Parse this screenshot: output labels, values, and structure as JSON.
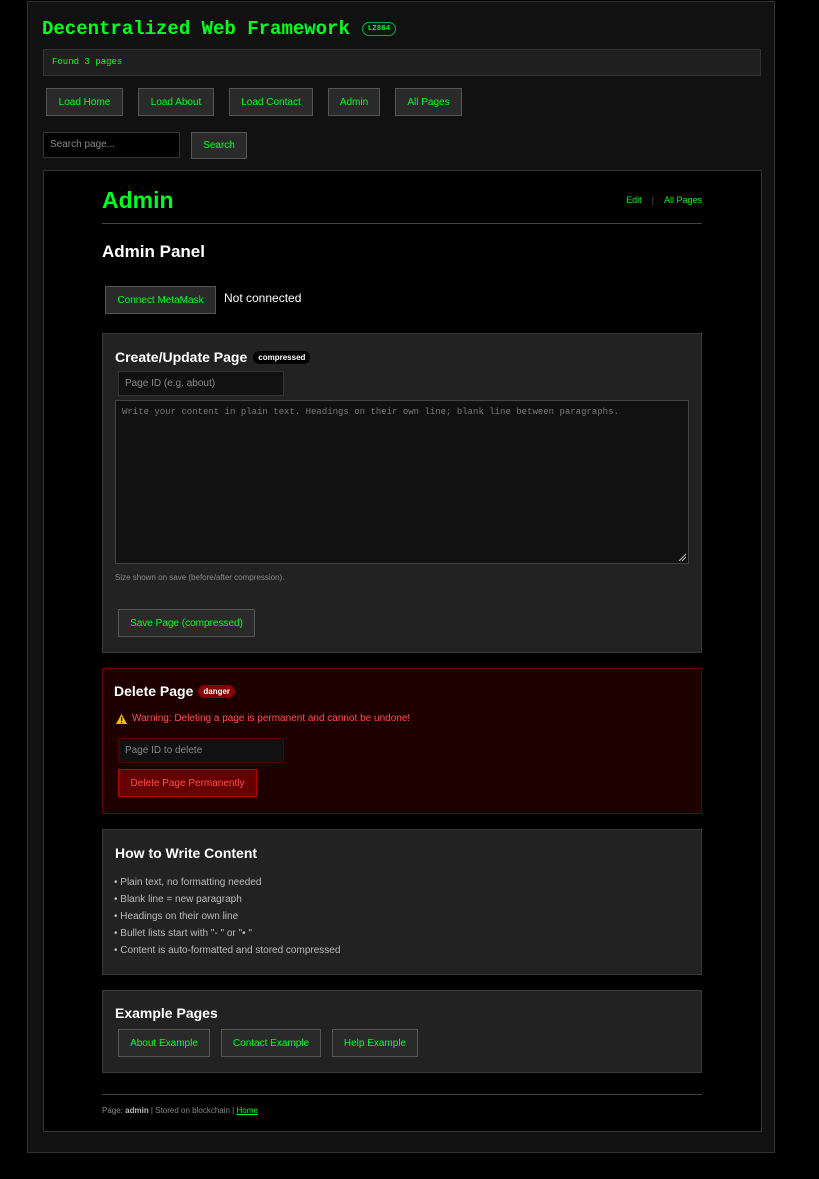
{
  "app": {
    "title": "Decentralized Web Framework",
    "badge": "LZ864"
  },
  "status": {
    "text": "Found 3 pages"
  },
  "nav": {
    "items": [
      {
        "label": "Load Home"
      },
      {
        "label": "Load About"
      },
      {
        "label": "Load Contact"
      },
      {
        "label": "Admin"
      },
      {
        "label": "All Pages"
      }
    ]
  },
  "search": {
    "placeholder": "Search page...",
    "button_label": "Search"
  },
  "page": {
    "title": "Admin",
    "links": {
      "edit": "Edit",
      "separator": "|",
      "all_pages": "All Pages"
    }
  },
  "admin": {
    "heading": "Admin Panel",
    "connect_button": "Connect MetaMask",
    "connection_status": "Not connected"
  },
  "create": {
    "heading": "Create/Update Page",
    "badge": "compressed",
    "page_id_placeholder": "Page ID (e.g. about)",
    "content_placeholder": "Write your content in plain text. Headings on their own line; blank line between paragraphs.",
    "hint": "Size shown on save (before/after compression).",
    "save_button": "Save Page (compressed)"
  },
  "delete": {
    "heading": "Delete Page",
    "badge": "danger",
    "warning": "Warning: Deleting a page is permanent and cannot be undone!",
    "page_id_placeholder": "Page ID to delete",
    "delete_button": "Delete Page Permanently"
  },
  "howto": {
    "heading": "How to Write Content",
    "tips": [
      "• Plain text, no formatting needed",
      "• Blank line = new paragraph",
      "• Headings on their own line",
      "• Bullet lists start with \"- \" or \"• \"",
      "• Content is auto-formatted and stored compressed"
    ]
  },
  "examples": {
    "heading": "Example Pages",
    "buttons": [
      {
        "label": "About Example"
      },
      {
        "label": "Contact Example"
      },
      {
        "label": "Help Example"
      }
    ]
  },
  "footer": {
    "prefix": "Page: ",
    "page_name": "admin",
    "middle": " | Stored on blockchain | ",
    "home_link": "Home"
  },
  "colors": {
    "accent": "#00ff1f",
    "background": "#000000",
    "panel": "#222222",
    "danger_bg": "#1f0000",
    "danger_text": "#ff4d4d"
  },
  "icons": {
    "warning": "warning-icon",
    "resize": "resize-handle-icon"
  }
}
